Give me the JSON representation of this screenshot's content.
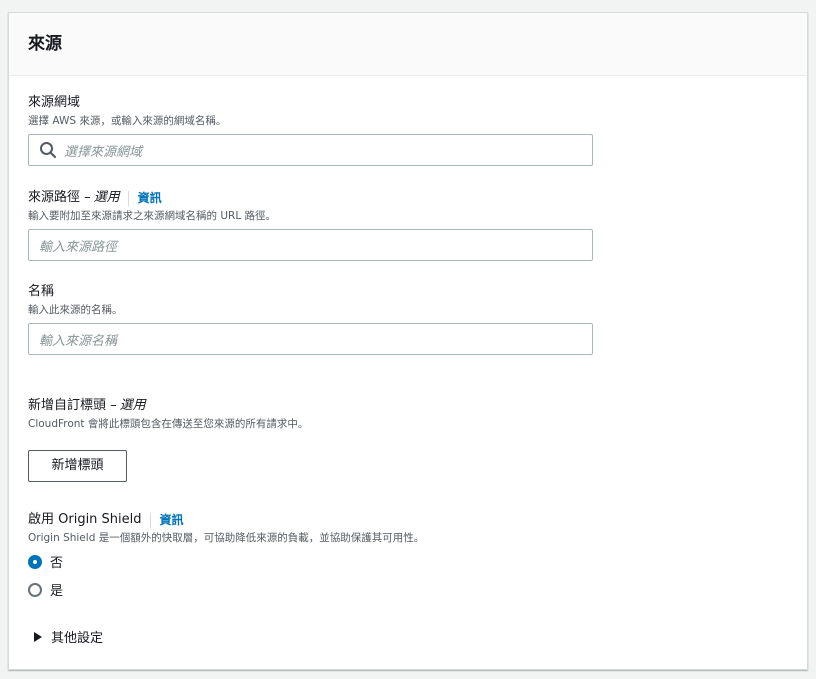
{
  "panel": {
    "title": "來源"
  },
  "origin_domain": {
    "label": "來源網域",
    "description": "選擇 AWS 來源，或輸入來源的網域名稱。",
    "placeholder": "選擇來源網域"
  },
  "origin_path": {
    "label": "來源路徑 –",
    "optional": "選用",
    "info": "資訊",
    "description": "輸入要附加至來源請求之來源網域名稱的 URL 路徑。",
    "placeholder": "輸入來源路徑"
  },
  "name": {
    "label": "名稱",
    "description": "輸入此來源的名稱。",
    "placeholder": "輸入來源名稱"
  },
  "custom_header": {
    "label": "新增自訂標頭 –",
    "optional": "選用",
    "description": "CloudFront 會將此標頭包含在傳送至您來源的所有請求中。",
    "button": "新增標頭"
  },
  "origin_shield": {
    "label": "啟用 Origin Shield",
    "info": "資訊",
    "description": "Origin Shield 是一個額外的快取層，可協助降低來源的負載，並協助保護其可用性。",
    "options": [
      "否",
      "是"
    ],
    "selected": "否"
  },
  "additional_settings": {
    "label": "其他設定"
  },
  "colors": {
    "link": "#0073bb",
    "radio_selected": "#0073bb",
    "border": "#aab7b8"
  }
}
